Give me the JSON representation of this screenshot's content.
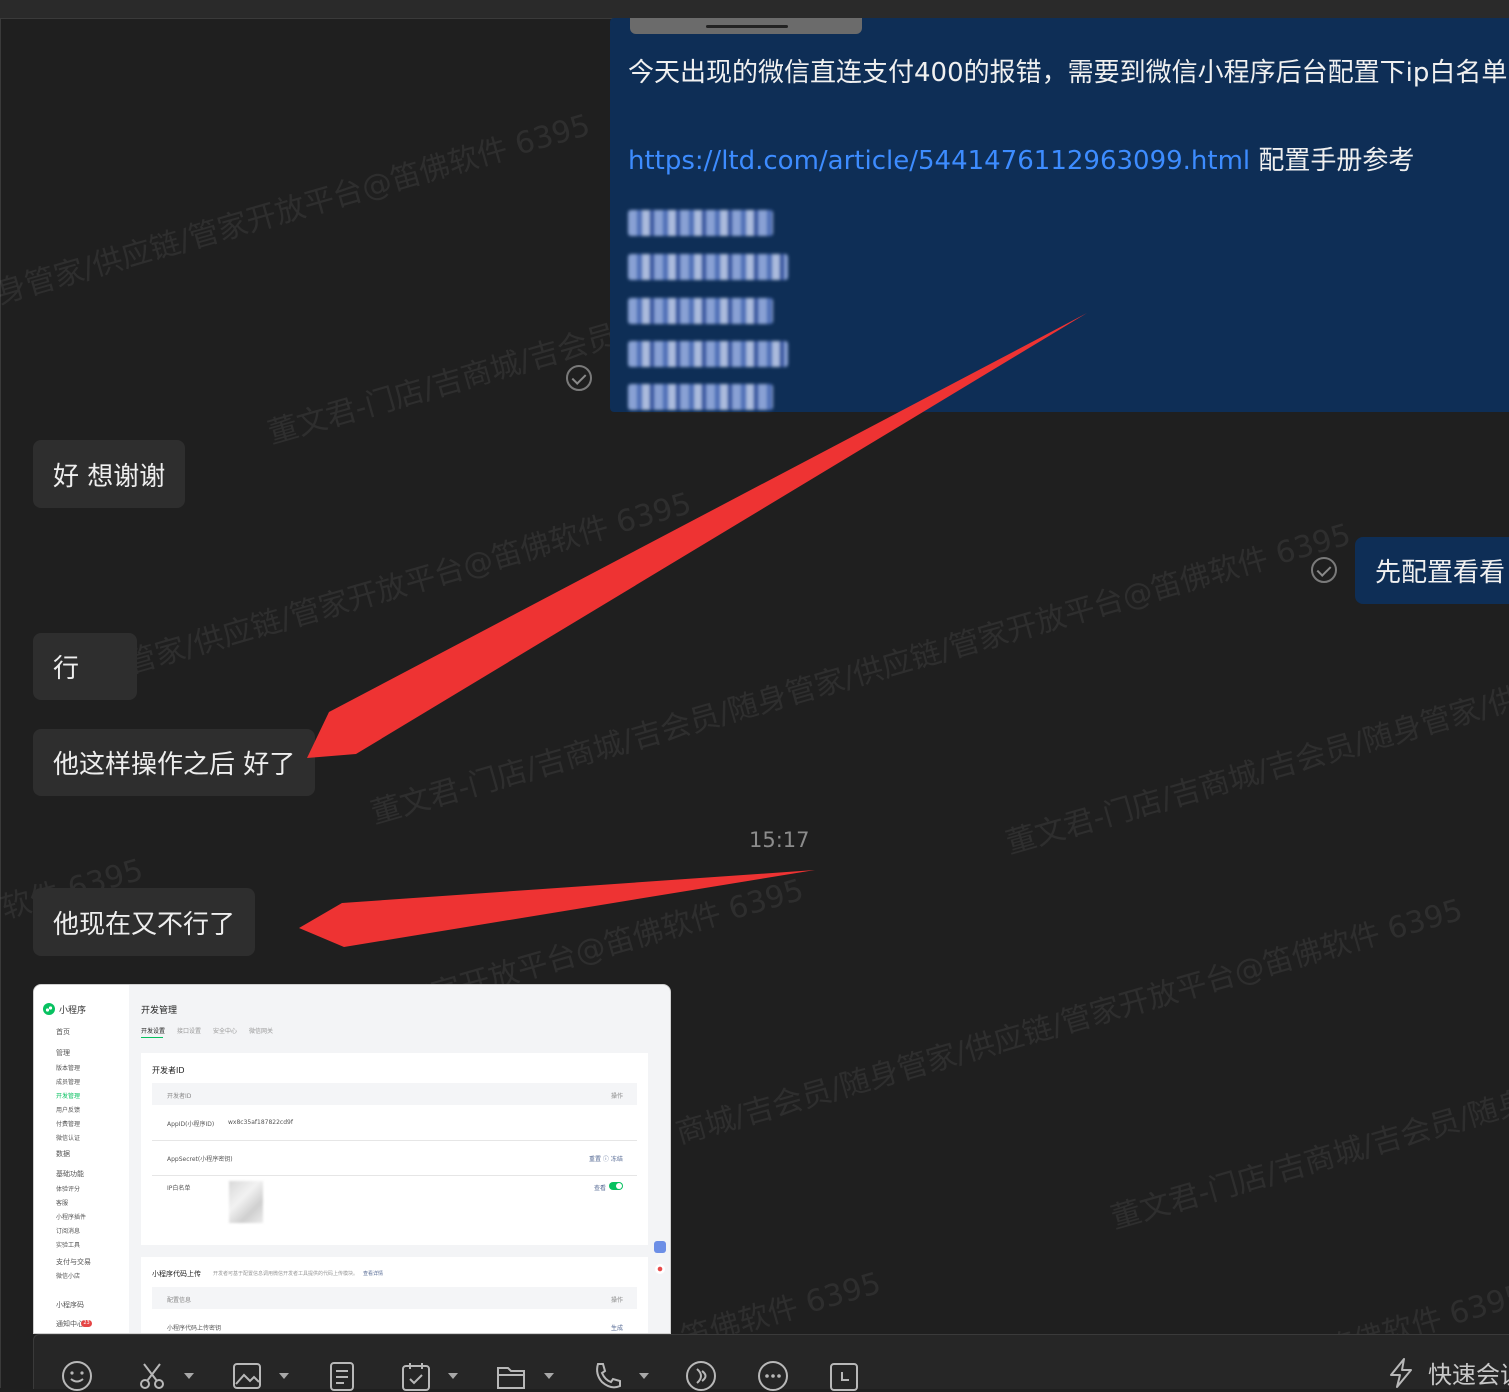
{
  "watermark_texts": [
    "身管家/供应链/管家开放平台@笛佛软件 6395",
    "董文君-门店/吉商城/吉会员/",
    "董文君-门店/吉商城/吉会员/随身管家/供应链/管家开放平台@笛佛软件 6395",
    "董文君-门店/吉商城/吉会员/随身管家/供应链/",
    "管家/供应链/管家开放平台@笛佛软件 6395",
    "/供应链/管家开放平台@笛佛软件 6395",
    "商城/吉会员/随身管家/供应链/管家开放平台@笛佛软件 6395",
    "董文君-门店/吉商城/吉会员/随身",
    "笛佛软件 6395",
    "@笛佛软件 6395",
    "软件 6395"
  ],
  "messages": {
    "outgoing_main": {
      "text": "今天出现的微信直连支付400的报错，需要到微信小程序后台配置下ip白名单",
      "link": "https://ltd.com/article/5441476112963099.html",
      "link_suffix": " 配置手册参考"
    },
    "incoming_1": "好 想谢谢",
    "outgoing_2": "先配置看看",
    "incoming_2": "行",
    "incoming_3": "他这样操作之后 好了",
    "timestamp": "15:17",
    "incoming_4": "他现在又不行了"
  },
  "screenshot": {
    "logo": "小程序",
    "page_title": "开发管理",
    "tabs": [
      "开发设置",
      "接口设置",
      "安全中心",
      "微信网关"
    ],
    "nav": [
      "首页",
      "管理",
      "版本管理",
      "成员管理",
      "开发管理",
      "用户反馈",
      "付费管理",
      "微信认证",
      "数据",
      "基础功能",
      "体验评分",
      "客服",
      "小程序插件",
      "订阅消息",
      "实验工具",
      "支付与交易",
      "微信小店",
      "小程序码",
      "通知中心"
    ],
    "section1_title": "开发者ID",
    "col_left": "开发者ID",
    "col_right": "操作",
    "appid_label": "AppID(小程序ID)",
    "appid_value": "wx8c35af187822cd9f",
    "secret_label": "AppSecret(小程序密钥)",
    "secret_action": "重置 ⓘ 冻结",
    "ip_label": "IP白名单",
    "ip_action": "查看",
    "section2_title": "小程序代码上传",
    "section2_desc": "开发者可基于配置信息调用微信开发者工具提供的代码上传模块。",
    "section2_link": "查看详情",
    "row2_left": "配置信息",
    "row2_right": "操作",
    "row3_left": "小程序代码上传密钥",
    "row3_right": "生成",
    "notify_badge": "23"
  },
  "toolbar": {
    "icons": [
      "emoji-icon",
      "scissors-icon",
      "image-icon",
      "document-icon",
      "calendar-check-icon",
      "folder-icon",
      "phone-icon",
      "voice-icon",
      "more-icon",
      "clock-icon"
    ],
    "quick_meeting": "快速会议"
  },
  "colors": {
    "background": "#1f1f1f",
    "outgoing_bubble": "#0e2e56",
    "incoming_bubble": "#2e2e2e",
    "link": "#3d8cff",
    "arrow": "#ee3333"
  }
}
